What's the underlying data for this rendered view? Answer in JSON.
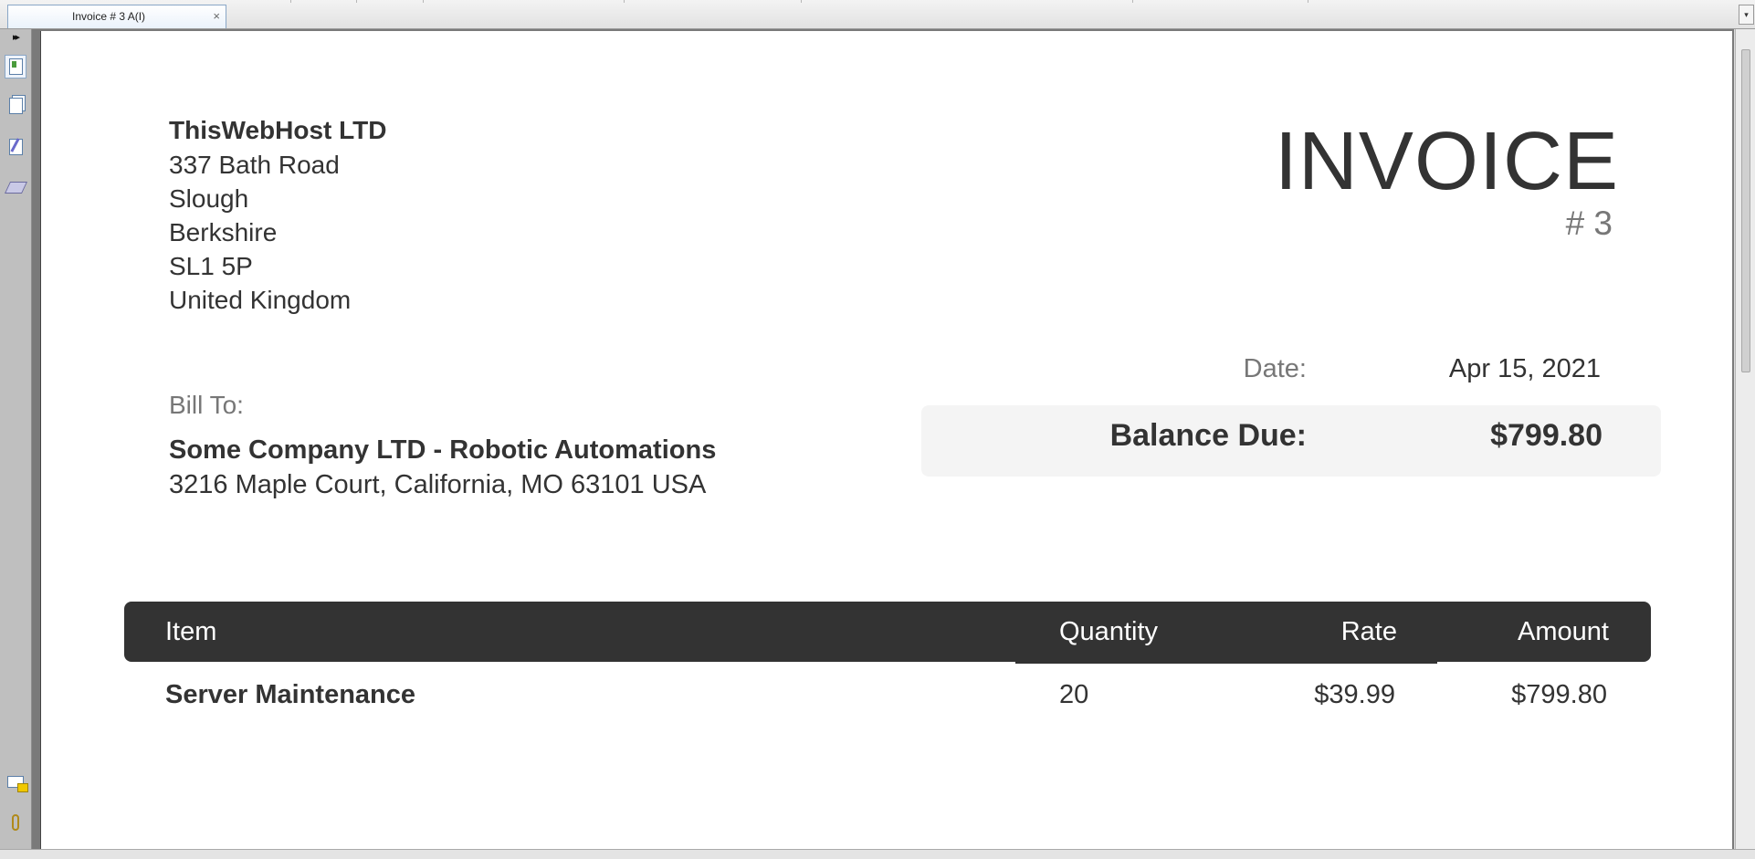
{
  "tab": {
    "title": "Invoice # 3 A(I)",
    "close_glyph": "×",
    "menu_glyph": "▾"
  },
  "sidebar": {
    "expand_glyph": "▸▸",
    "icons": [
      "page-thumbnails-icon",
      "pages-icon",
      "signatures-icon",
      "layers-icon",
      "comments-icon",
      "attachments-icon"
    ]
  },
  "invoice": {
    "company": {
      "name": "ThisWebHost LTD",
      "address_lines": [
        "337 Bath Road",
        "Slough",
        "Berkshire",
        "SL1 5P",
        "United Kingdom"
      ]
    },
    "title": "INVOICE",
    "number": "# 3",
    "date_label": "Date:",
    "date_value": "Apr 15, 2021",
    "balance_label": "Balance Due:",
    "balance_value": "$799.80",
    "bill_to_label": "Bill To:",
    "client_name": "Some Company LTD - Robotic Automations",
    "client_address": "3216 Maple Court, California, MO 63101 USA",
    "table": {
      "headers": {
        "item": "Item",
        "quantity": "Quantity",
        "rate": "Rate",
        "amount": "Amount"
      },
      "rows": [
        {
          "item": "Server Maintenance",
          "quantity": "20",
          "rate": "$39.99",
          "amount": "$799.80"
        }
      ]
    }
  }
}
